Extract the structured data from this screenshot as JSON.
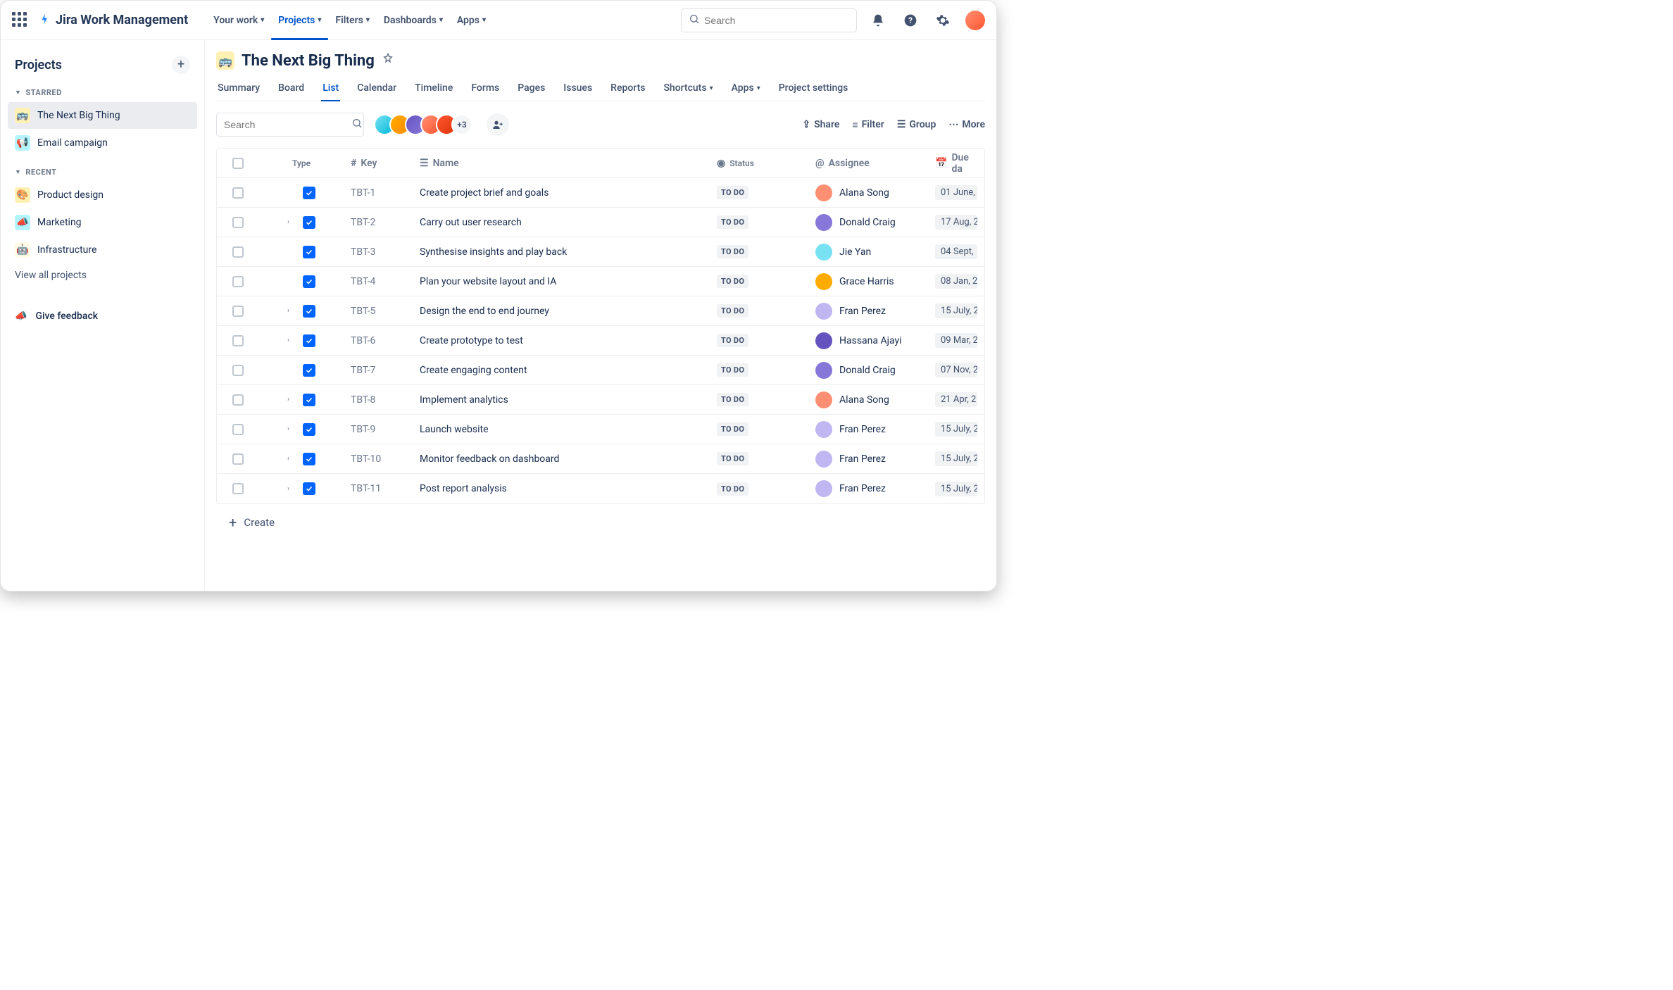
{
  "topnav": {
    "product": "Jira Work Management",
    "items": [
      "Your work",
      "Projects",
      "Filters",
      "Dashboards",
      "Apps"
    ],
    "activeIndex": 1,
    "searchPlaceholder": "Search"
  },
  "sidebar": {
    "title": "Projects",
    "starredLabel": "STARRED",
    "recentLabel": "RECENT",
    "starred": [
      {
        "icon": "🚌",
        "label": "The Next Big Thing",
        "active": true
      },
      {
        "icon": "📢",
        "label": "Email campaign",
        "active": false
      }
    ],
    "recent": [
      {
        "icon": "🎨",
        "label": "Product design"
      },
      {
        "icon": "📣",
        "label": "Marketing"
      },
      {
        "icon": "🤖",
        "label": "Infrastructure"
      }
    ],
    "viewAll": "View all projects",
    "feedback": "Give feedback"
  },
  "project": {
    "icon": "🚌",
    "title": "The Next Big Thing",
    "tabs": [
      "Summary",
      "Board",
      "List",
      "Calendar",
      "Timeline",
      "Forms",
      "Pages",
      "Issues",
      "Reports",
      "Shortcuts",
      "Apps",
      "Project settings"
    ],
    "activeTab": 2,
    "listSearchPlaceholder": "Search",
    "moreAvatars": "+3",
    "toolbar": {
      "share": "Share",
      "filter": "Filter",
      "group": "Group",
      "more": "More"
    }
  },
  "table": {
    "columns": {
      "type": "Type",
      "key": "Key",
      "name": "Name",
      "status": "Status",
      "assignee": "Assignee",
      "due": "Due da"
    },
    "rows": [
      {
        "expand": false,
        "key": "TBT-1",
        "name": "Create project brief and goals",
        "status": "TO DO",
        "assignee": "Alana Song",
        "avColor": "#FF8F73",
        "due": "01 June,"
      },
      {
        "expand": true,
        "key": "TBT-2",
        "name": "Carry out user research",
        "status": "TO DO",
        "assignee": "Donald Craig",
        "avColor": "#8777D9",
        "due": "17 Aug, 2"
      },
      {
        "expand": false,
        "key": "TBT-3",
        "name": "Synthesise insights and play back",
        "status": "TO DO",
        "assignee": "Jie Yan",
        "avColor": "#79E2F2",
        "due": "04 Sept,"
      },
      {
        "expand": false,
        "key": "TBT-4",
        "name": "Plan your website layout and IA",
        "status": "TO DO",
        "assignee": "Grace Harris",
        "avColor": "#FFAB00",
        "due": "08 Jan, 2"
      },
      {
        "expand": true,
        "key": "TBT-5",
        "name": "Design the end to end journey",
        "status": "TO DO",
        "assignee": "Fran Perez",
        "avColor": "#C0B6F2",
        "due": "15 July, 2"
      },
      {
        "expand": true,
        "key": "TBT-6",
        "name": "Create prototype to test",
        "status": "TO DO",
        "assignee": "Hassana Ajayi",
        "avColor": "#6554C0",
        "due": "09 Mar, 2"
      },
      {
        "expand": false,
        "key": "TBT-7",
        "name": "Create engaging content",
        "status": "TO DO",
        "assignee": "Donald Craig",
        "avColor": "#8777D9",
        "due": "07 Nov, 2"
      },
      {
        "expand": true,
        "key": "TBT-8",
        "name": "Implement analytics",
        "status": "TO DO",
        "assignee": "Alana Song",
        "avColor": "#FF8F73",
        "due": "21 Apr, 2"
      },
      {
        "expand": true,
        "key": "TBT-9",
        "name": "Launch website",
        "status": "TO DO",
        "assignee": "Fran Perez",
        "avColor": "#C0B6F2",
        "due": "15 July, 2"
      },
      {
        "expand": true,
        "key": "TBT-10",
        "name": "Monitor feedback on dashboard",
        "status": "TO DO",
        "assignee": "Fran Perez",
        "avColor": "#C0B6F2",
        "due": "15 July, 2"
      },
      {
        "expand": true,
        "key": "TBT-11",
        "name": "Post report analysis",
        "status": "TO DO",
        "assignee": "Fran Perez",
        "avColor": "#C0B6F2",
        "due": "15 July, 2"
      }
    ],
    "create": "Create"
  }
}
